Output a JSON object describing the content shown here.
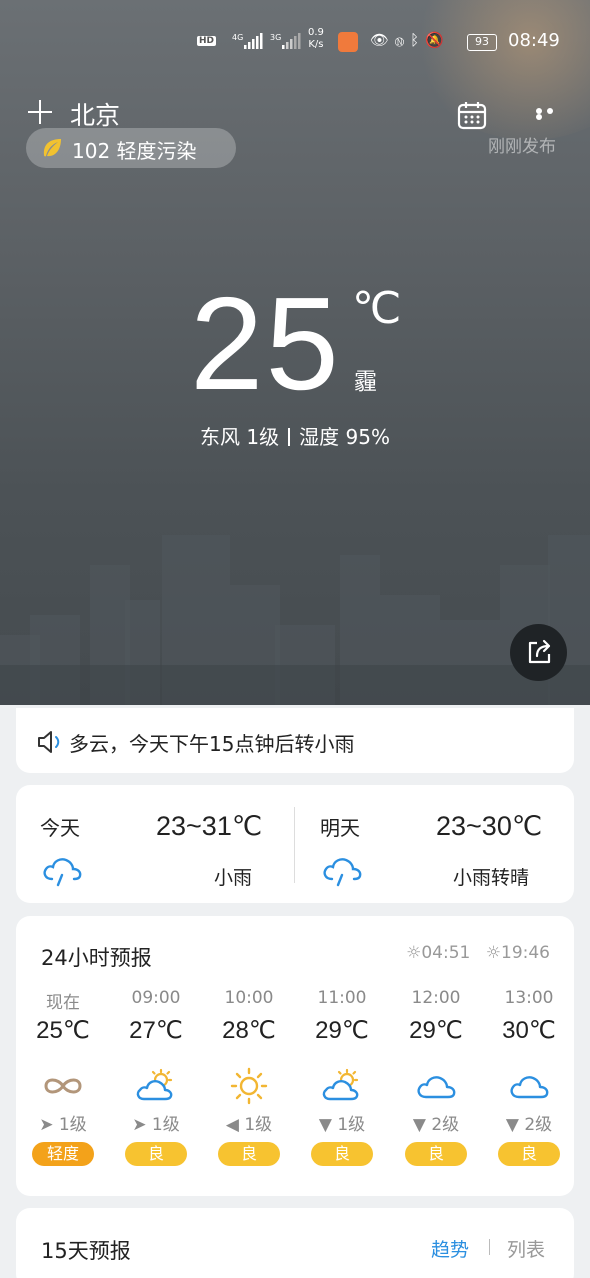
{
  "status_bar": {
    "hd": "HD",
    "sig1_label": "4G",
    "sig2_label": "3G",
    "speed_value": "0.9",
    "speed_unit": "K/s",
    "battery": "93",
    "time": "08:49"
  },
  "header": {
    "city": "北京",
    "published": "刚刚发布"
  },
  "aqi": {
    "value_text": "102 轻度污染"
  },
  "current": {
    "temperature": "25",
    "unit": "℃",
    "condition": "霾",
    "wind": "东风 1级",
    "humidity": "湿度 95%"
  },
  "notice": {
    "text": "多云，今天下午15点钟后转小雨"
  },
  "daily": {
    "today": {
      "label": "今天",
      "range": "23~31℃",
      "condition": "小雨"
    },
    "tomorrow": {
      "label": "明天",
      "range": "23~30℃",
      "condition": "小雨转晴"
    }
  },
  "hourly": {
    "title": "24小时预报",
    "sunrise": "04:51",
    "sunset": "19:46",
    "hours": [
      {
        "time": "现在",
        "temp": "25℃",
        "icon": "haze-icon",
        "wind": "1级",
        "aqi": "轻度"
      },
      {
        "time": "09:00",
        "temp": "27℃",
        "icon": "partly-cloudy-icon",
        "wind": "1级",
        "aqi": "良"
      },
      {
        "time": "10:00",
        "temp": "28℃",
        "icon": "sunny-icon",
        "wind": "1级",
        "aqi": "良"
      },
      {
        "time": "11:00",
        "temp": "29℃",
        "icon": "partly-cloudy-icon",
        "wind": "1级",
        "aqi": "良"
      },
      {
        "time": "12:00",
        "temp": "29℃",
        "icon": "cloudy-icon",
        "wind": "2级",
        "aqi": "良"
      },
      {
        "time": "13:00",
        "temp": "30℃",
        "icon": "cloudy-icon",
        "wind": "2级",
        "aqi": "良"
      }
    ]
  },
  "forecast": {
    "title": "15天预报",
    "tab_trend": "趋势",
    "tab_list": "列表"
  },
  "colors": {
    "accent_blue": "#2b8fe0",
    "aqi_good": "#f7c330",
    "aqi_light": "#f3a21a"
  }
}
